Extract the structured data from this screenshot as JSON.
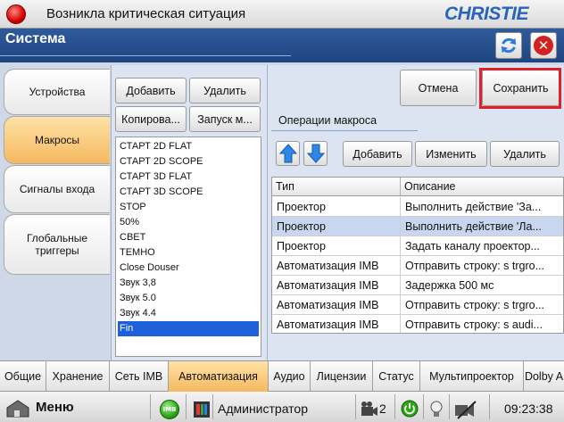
{
  "topbar": {
    "alert_text": "Возникла критическая ситуация",
    "brand": "CHRISTIE",
    "status_color": "#d50000",
    "brand_color": "#2a64b8"
  },
  "header": {
    "title": "Система",
    "refresh_icon": "refresh-icon",
    "close_symbol": "✕"
  },
  "left_tabs": [
    {
      "label": "Устройства",
      "active": false
    },
    {
      "label": "Макросы",
      "active": true
    },
    {
      "label": "Сигналы входа",
      "active": false
    },
    {
      "label": "Глобальные\nтриггеры",
      "active": false
    }
  ],
  "middle": {
    "add_label": "Добавить",
    "delete_label": "Удалить",
    "copy_label": "Копирова...",
    "run_label": "Запуск м...",
    "macros": [
      "СТАРТ 2D FLAT",
      "СТАРТ 2D SCOPE",
      "СТАРТ 3D FLAT",
      "СТАРТ 3D SCOPE",
      "STOP",
      "50%",
      "СВЕТ",
      "ТЕМНО",
      "Close Douser",
      "Звук 3,8",
      "Звук 5.0",
      "Звук 4.4",
      "Fin"
    ],
    "selected_macro": "Fin"
  },
  "right": {
    "cancel_label": "Отмена",
    "save_label": "Сохранить",
    "ops_heading": "Операции макроса",
    "add_label": "Добавить",
    "edit_label": "Изменить",
    "delete_label": "Удалить",
    "columns": [
      "Тип",
      "Описание"
    ],
    "rows": [
      [
        "Проектор",
        "Выполнить действие 'За..."
      ],
      [
        "Проектор",
        "Выполнить действие 'Ла..."
      ],
      [
        "Проектор",
        "Задать каналу проектор..."
      ],
      [
        "Автоматизация IMB",
        "Отправить строку: s trgro..."
      ],
      [
        "Автоматизация IMB",
        "Задержка 500 мс"
      ],
      [
        "Автоматизация IMB",
        "Отправить строку: s trgro..."
      ],
      [
        "Автоматизация IMB",
        "Отправить строку: s audi..."
      ]
    ],
    "selected_row": 1,
    "highlight_color": "#e0202a"
  },
  "bottom_tabs": [
    {
      "label": "Общие",
      "active": false
    },
    {
      "label": "Хранение",
      "active": false
    },
    {
      "label": "Сеть IMB",
      "active": false
    },
    {
      "label": "Автоматизация",
      "active": true
    },
    {
      "label": "Аудио",
      "active": false
    },
    {
      "label": "Лицензии",
      "active": false
    },
    {
      "label": "Статус",
      "active": false
    },
    {
      "label": "Мультипроектор",
      "active": false
    },
    {
      "label": "Dolby A",
      "active": false
    }
  ],
  "statusbar": {
    "menu_label": "Меню",
    "imb_label": "IMB",
    "user_label": "Администратор",
    "count_label": "2",
    "clock": "09:23:38"
  }
}
